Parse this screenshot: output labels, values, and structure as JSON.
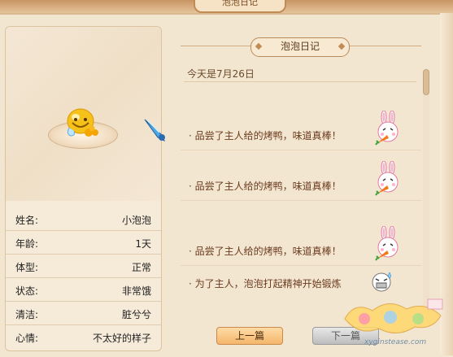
{
  "window": {
    "tab_title": "泡泡日记"
  },
  "pet": {
    "stats": [
      {
        "label": "姓名:",
        "value": "小泡泡"
      },
      {
        "label": "年龄:",
        "value": "1天"
      },
      {
        "label": "体型:",
        "value": "正常"
      },
      {
        "label": "状态:",
        "value": "非常饿"
      },
      {
        "label": "清洁:",
        "value": "脏兮兮"
      },
      {
        "label": "心情:",
        "value": "不太好的样子"
      }
    ]
  },
  "diary": {
    "title": "泡泡日记",
    "date_line": "今天是7月26日",
    "entries": [
      {
        "text": "· 品尝了主人给的烤鸭，味道真棒！",
        "icon": "bunny-eating-carrot-icon"
      },
      {
        "text": "· 品尝了主人给的烤鸭，味道真棒！",
        "icon": "bunny-eating-carrot-icon"
      },
      {
        "text": "· 品尝了主人给的烤鸭，味道真棒！",
        "icon": "bunny-eating-carrot-icon"
      },
      {
        "text": "· 为了主人，泡泡打起精神开始锻炼",
        "icon": "sweating-face-icon"
      }
    ],
    "prev_label": "上一篇",
    "next_label": "下一篇"
  },
  "watermark": {
    "text": "xyginstease.com"
  }
}
